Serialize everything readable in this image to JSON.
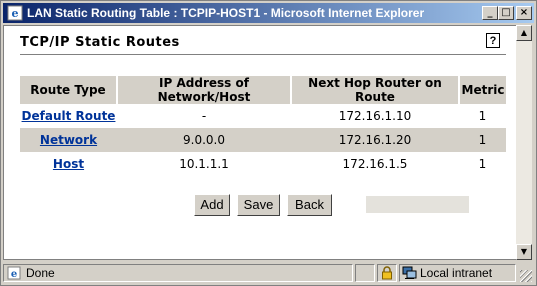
{
  "window": {
    "title": "LAN Static Routing Table : TCPIP-HOST1 - Microsoft Internet Explorer",
    "minimize": "_",
    "maximize": "□",
    "close": "×"
  },
  "page": {
    "title": "TCP/IP Static Routes",
    "help": "?"
  },
  "table": {
    "headers": [
      "Route Type",
      "IP Address of Network/Host",
      "Next Hop Router on Route",
      "Metric"
    ],
    "rows": [
      {
        "type": "Default Route",
        "ip": "-",
        "next_hop": "172.16.1.10",
        "metric": "1"
      },
      {
        "type": "Network",
        "ip": "9.0.0.0",
        "next_hop": "172.16.1.20",
        "metric": "1"
      },
      {
        "type": "Host",
        "ip": "10.1.1.1",
        "next_hop": "172.16.1.5",
        "metric": "1"
      }
    ]
  },
  "buttons": {
    "add": "Add",
    "save": "Save",
    "back": "Back"
  },
  "status": {
    "text": "Done",
    "zone": "Local intranet"
  },
  "icons": {
    "browser": "ie-icon",
    "page": "page-icon",
    "lock": "lock-icon",
    "zone": "intranet-icon"
  },
  "colors": {
    "titlebar_start": "#0a246a",
    "titlebar_end": "#a6caf0",
    "link": "#003399",
    "chrome": "#d4d0c8"
  }
}
